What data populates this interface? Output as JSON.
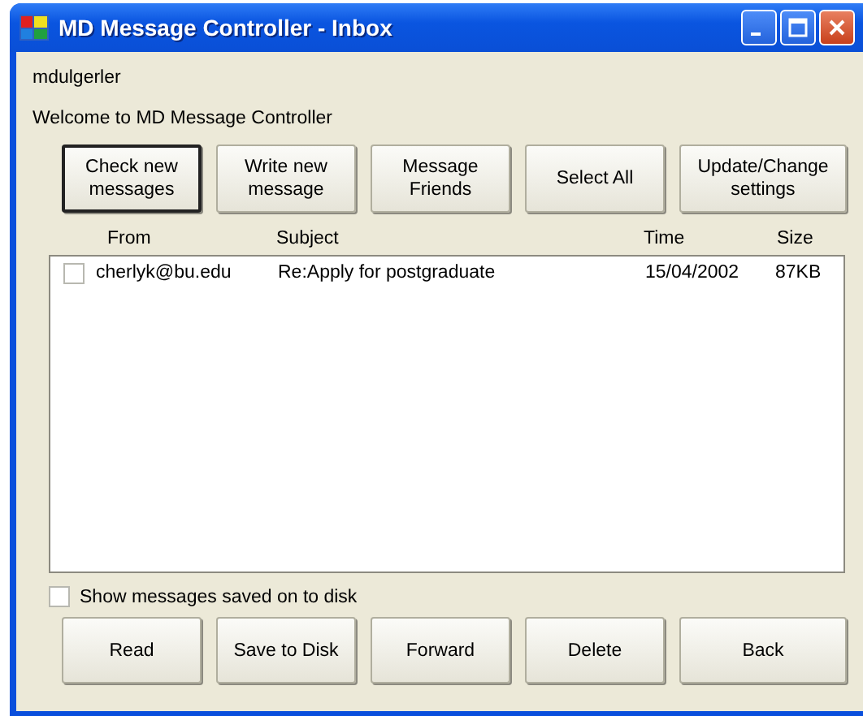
{
  "window": {
    "title": "MD Message Controller - Inbox"
  },
  "user": "mdulgerler",
  "welcome": "Welcome to MD Message Controller",
  "top_buttons": [
    {
      "label": "Check new messages",
      "focused": true
    },
    {
      "label": "Write new message",
      "focused": false
    },
    {
      "label": "Message Friends",
      "focused": false
    },
    {
      "label": "Select All",
      "focused": false
    },
    {
      "label": "Update/Change settings",
      "focused": false
    }
  ],
  "table": {
    "columns": [
      "From",
      "Subject",
      "Time",
      "Size"
    ],
    "rows": [
      {
        "checked": false,
        "cells": [
          "cherlyk@bu.edu",
          "Re:Apply for postgraduate",
          "15/04/2002",
          "87KB"
        ]
      }
    ]
  },
  "show_saved": {
    "label": "Show messages saved on to disk",
    "checked": false
  },
  "bottom_buttons": [
    {
      "label": "Read",
      "focused": false
    },
    {
      "label": "Save to Disk",
      "focused": false
    },
    {
      "label": "Forward",
      "focused": false
    },
    {
      "label": "Delete",
      "focused": false
    },
    {
      "label": "Back",
      "focused": false
    }
  ]
}
